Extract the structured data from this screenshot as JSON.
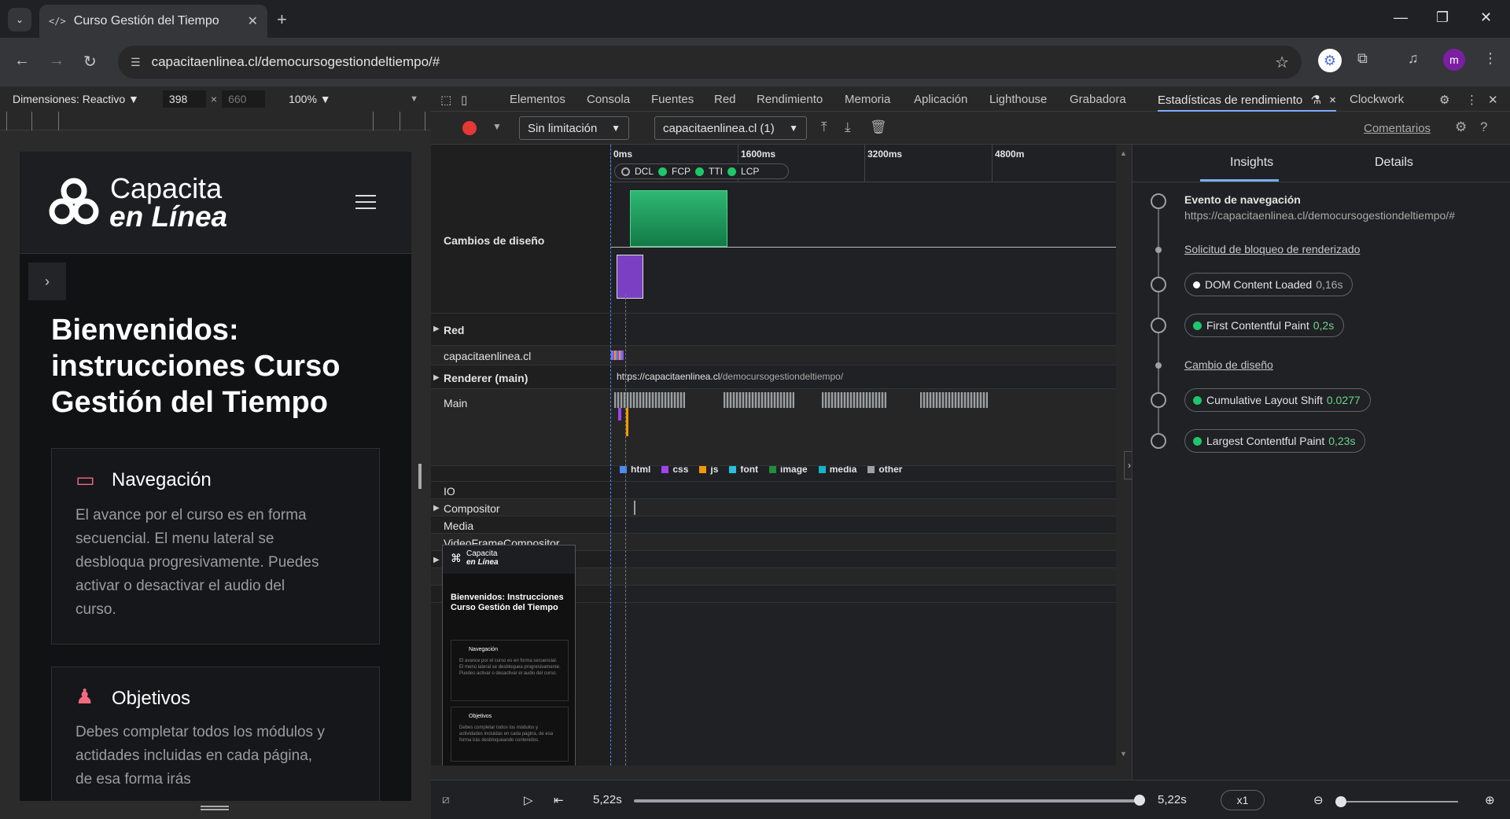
{
  "browser": {
    "tab_title": "Curso Gestión del Tiempo",
    "tab_favicon": "</>",
    "url": "capacitaenlinea.cl/democursogestiondeltiempo/#",
    "profile_initial": "m"
  },
  "device_toolbar": {
    "dimensions_label": "Dimensiones: Reactivo ▼",
    "width": "398",
    "times": "×",
    "height": "660",
    "zoom": "100% ▼",
    "more": "▼"
  },
  "page": {
    "logo_line1": "Capacita",
    "logo_line2": "en Línea",
    "title": "Bienvenidos: instrucciones Curso Gestión del Tiempo",
    "cards": [
      {
        "heading": "Navegación",
        "body": "El avance por el curso es en forma secuencial. El menu lateral se desbloqua progresivamente. Puedes activar o desactivar el audio del curso."
      },
      {
        "heading": "Objetivos",
        "body": "Debes completar todos los módulos y actidades incluidas en cada página, de esa forma irás"
      }
    ]
  },
  "devtools": {
    "tabs": [
      "Elementos",
      "Consola",
      "Fuentes",
      "Red",
      "Rendimiento",
      "Memoria",
      "Aplicación",
      "Lighthouse",
      "Grabadora",
      "Estadísticas de rendimiento",
      "Clockwork"
    ],
    "active_tab_close": "×",
    "throttle": "Sin limitación",
    "recording": "capacitaenlinea.cl (1)",
    "comments_link": "Comentarios",
    "timeline": {
      "ticks": [
        "0ms",
        "1600ms",
        "3200ms",
        "4800m"
      ],
      "markers": [
        "DCL",
        "FCP",
        "TTI",
        "LCP"
      ],
      "tracks": {
        "layout_shifts": "Cambios de diseño",
        "network": "Red",
        "network_host": "capacitaenlinea.cl",
        "renderer": "Renderer (main)",
        "renderer_url_prefix": "https://capacitaenlinea.cl",
        "renderer_url_path": "/democursogestiondeltiempo/",
        "main": "Main",
        "io": "IO",
        "compositor": "Compositor",
        "media": "Media",
        "video": "VideoFrameCompositor"
      },
      "legend": [
        "html",
        "css",
        "js",
        "font",
        "image",
        "media",
        "other"
      ],
      "legend_colors": [
        "#4c8bf5",
        "#a142f4",
        "#f29900",
        "#24c1e0",
        "#1e8e3e",
        "#12b5cb",
        "#9aa0a6"
      ],
      "thumb": {
        "logo1": "Capacita",
        "logo2": "en Línea",
        "title": "Bienvenidos: Instrucciones Curso Gestión del Tiempo",
        "card1": "Navegación",
        "card1_body": "El avance por el curso es en forma secuencial. El menú lateral se desbloquea progresivamente. Puedes activar o desactivar el audio del curso.",
        "card2": "Objetivos",
        "card2_body": "Debes completar todos los módulos y actividades incluidas en cada página, de esa forma irás desbloqueando contenidos."
      }
    },
    "insights": {
      "tabs": [
        "Insights",
        "Details"
      ],
      "nav_title": "Evento de navegación",
      "nav_url": "https://capacitaenlinea.cl/democursogestiondeltiempo/#",
      "render_blocking": "Solicitud de bloqueo de renderizado",
      "dcl_label": "DOM Content Loaded",
      "dcl_value": "0,16s",
      "fcp_label": "First Contentful Paint",
      "fcp_value": "0,2s",
      "layout_shift": "Cambio de diseño",
      "cls_label": "Cumulative Layout Shift",
      "cls_value": "0.0277",
      "lcp_label": "Largest Contentful Paint",
      "lcp_value": "0,23s"
    },
    "bottom": {
      "start_time": "5,22s",
      "end_time": "5,22s",
      "speed": "x1"
    }
  }
}
